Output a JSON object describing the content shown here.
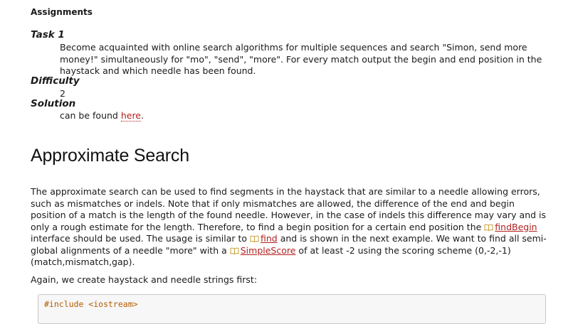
{
  "assignments": {
    "heading": "Assignments",
    "task_label": "Task 1",
    "task_text": "Become acquainted with online search algorithms for multiple sequences and search \"Simon, send more money!\" simultaneously for \"mo\", \"send\", \"more\". For every match output the begin and end position in the haystack and which needle has been found.",
    "difficulty_label": "Difficulty",
    "difficulty_value": "2",
    "solution_label": "Solution",
    "solution_prefix": "can be found ",
    "solution_link": "here",
    "solution_suffix": "."
  },
  "section": {
    "title": "Approximate Search",
    "p1_a": "The approximate search can be used to find segments in the haystack that are similar to a needle allowing errors, such as mismatches or indels. Note that if only mismatches are allowed, the difference of the end and begin position of a match is the length of the found needle. However, in the case of indels this difference may vary and is only a rough estimate for the length. Therefore, to find a begin position for a certain end position the ",
    "link_findbegin": "findBegin",
    "p1_b": " interface should be used. The usage is similar to ",
    "link_find": "find",
    "p1_c": " and is shown in the next example. We want to find all semi-global alignments of a needle \"more\" with a ",
    "link_simplescore": "SimpleScore",
    "p1_d": " of at least -2 using the scoring scheme (0,-2,-1) (match,mismatch,gap).",
    "p2": "Again, we create haystack and needle strings first:",
    "code_first_line": "#include <iostream>"
  },
  "colors": {
    "link": "#b21f1f",
    "code_include": "#b35c00"
  },
  "icons": {
    "api_reference": "book-icon"
  }
}
